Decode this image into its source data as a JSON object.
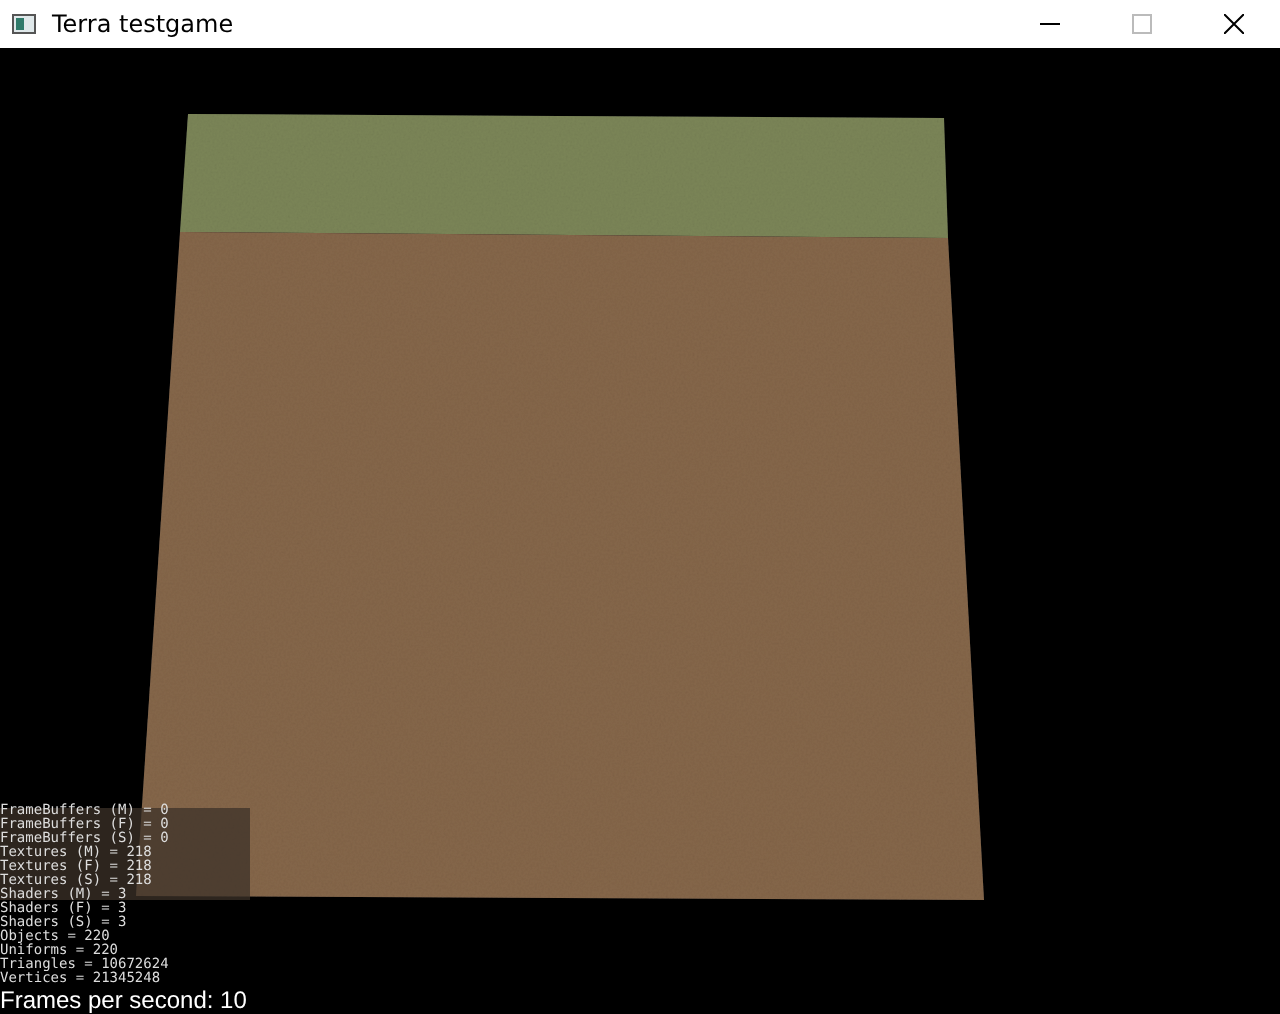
{
  "window": {
    "title": "Terra testgame"
  },
  "stats": [
    "FrameBuffers (M) = 0",
    "FrameBuffers (F) = 0",
    "FrameBuffers (S) = 0",
    "Textures (M) = 218",
    "Textures (F) = 218",
    "Textures (S) = 218",
    "Shaders (M) = 3",
    "Shaders (F) = 3",
    "Shaders (S) = 3",
    "Objects = 220",
    "Uniforms = 220",
    "Triangles = 10672624",
    "Vertices = 21345248"
  ],
  "fps": "Frames per second: 10"
}
